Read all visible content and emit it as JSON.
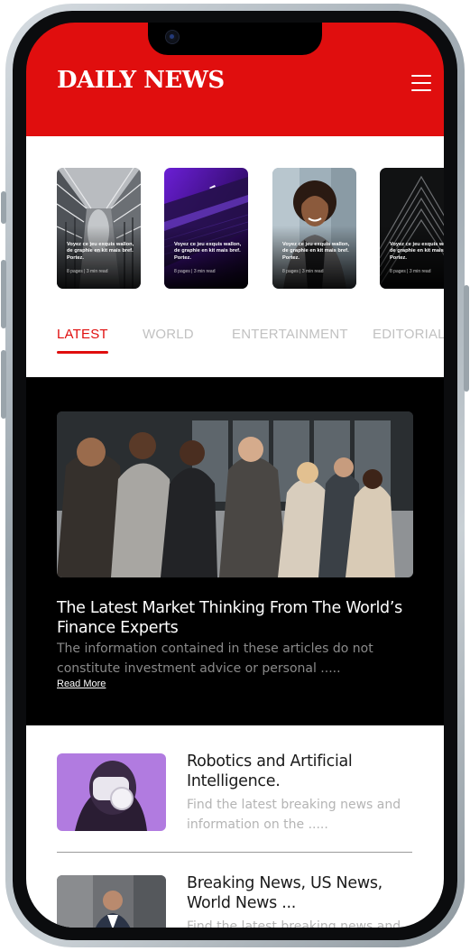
{
  "app": {
    "logo": "DAILY NEWS",
    "brand_color": "#e00e0e"
  },
  "header": {
    "menu_icon": "hamburger-menu-icon"
  },
  "stories": [
    {
      "title": "Voyez ce jeu exquis wallon, de graphie en kit mais bref. Portez.",
      "meta": "8 pages | 3 min read"
    },
    {
      "title": "Voyez ce jeu exquis wallon, de graphie en kit mais bref. Portez.",
      "meta": "8 pages | 3 min read"
    },
    {
      "title": "Voyez ce jeu exquis wallon, de graphie en kit mais bref. Portez.",
      "meta": "8 pages | 3 min read"
    },
    {
      "title": "Voyez ce jeu exquis wallon, de graphie en kit mais bref. Portez.",
      "meta": "8 pages | 3 min read"
    }
  ],
  "tabs": [
    {
      "label": "LATEST",
      "active": true
    },
    {
      "label": "WORLD",
      "active": false
    },
    {
      "label": "ENTERTAINMENT",
      "active": false
    },
    {
      "label": "EDITORIAL",
      "active": false
    }
  ],
  "featured": {
    "title": "The Latest Market Thinking From The World’s Finance Experts",
    "description": "The information contained in these articles do not constitute investment advice or personal .....",
    "read_more": "Read More"
  },
  "articles": [
    {
      "title": "Robotics and Artificial Intelligence.",
      "description": "Find the latest breaking news and information on the ....."
    },
    {
      "title": "Breaking News, US News, World News ...",
      "description": "Find the latest breaking news and"
    }
  ]
}
